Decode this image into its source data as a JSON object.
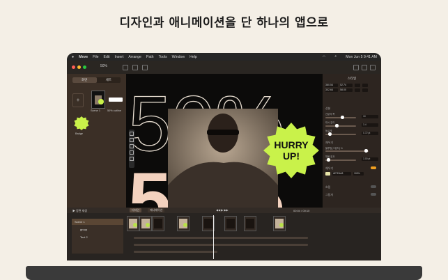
{
  "headline": "디자인과 애니메이션을 단 하나의 앱으로",
  "colors": {
    "accent": "#c9f24a",
    "canvas": "#0c0b0a",
    "sidebar": "#3b2f26",
    "numeral": "#f3d2bf"
  },
  "menubar": {
    "app": "Meve",
    "items": [
      "File",
      "Edit",
      "Insert",
      "Arrange",
      "Path",
      "Tools",
      "Window",
      "Help"
    ],
    "clock": "Mon Jun 5  9:41 AM"
  },
  "toolbar": {
    "zoom": "50%"
  },
  "sidebar": {
    "tabs": [
      "화면",
      "세트"
    ],
    "scene_label": "Scene 1",
    "outline_label": "50% outline",
    "badge_label": "Badge"
  },
  "canvas": {
    "big_text": "50%",
    "badge_line1": "HURRY",
    "badge_line2": "UP!"
  },
  "inspector": {
    "title": "스타일",
    "fields": [
      "380.54",
      "52.74",
      "302.64",
      "58.00"
    ],
    "section_stroke": "선분",
    "stroke_rows": [
      "선분의 폭",
      "대시 길이",
      "둥글게"
    ],
    "stroke_values": [
      "10",
      "3.4",
      "0.72 pt"
    ],
    "section_shadow": "채우기",
    "shadow_rows": [
      "블루밍(그림자) %",
      "채움 효과"
    ],
    "shadow_values": [
      "0",
      "3.00 pt"
    ],
    "section_fill": "채우기",
    "fill_hex": "#E7E4A8",
    "fill_pct": "100%",
    "section_blur": "흐림",
    "section_shadow2": "그림자"
  },
  "timeline": {
    "left_label": "▶ 장면 재생",
    "mode_label": "디자인",
    "mode2_label": "애니메이션",
    "time": "00:04 / 00:10",
    "frames": [
      "0:00",
      "0:01",
      "0:02",
      "0:03",
      "0:04",
      "0:05",
      "0:06",
      "0:07",
      "0:08",
      "0:09",
      "0:10"
    ],
    "layers": [
      "Scene 1",
      "group",
      "Text 2"
    ]
  }
}
